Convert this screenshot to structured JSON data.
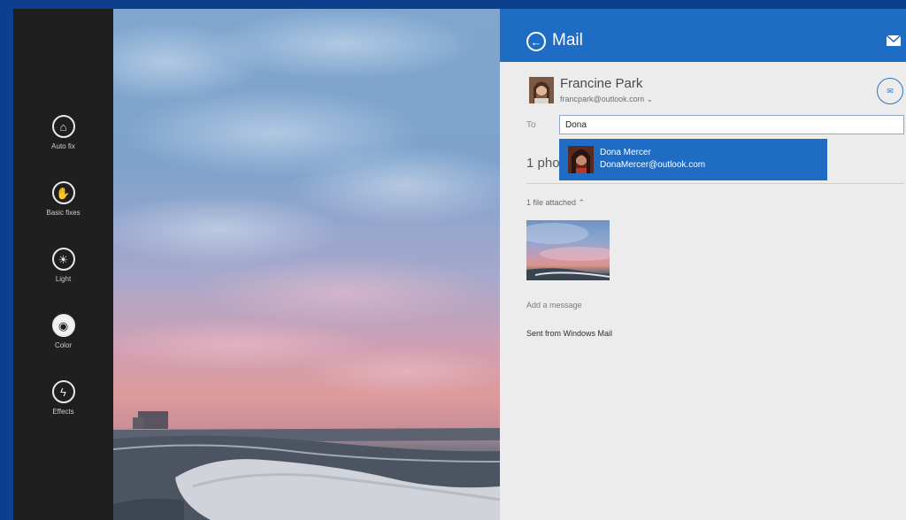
{
  "toolbar": {
    "items": [
      {
        "label": "Auto fix",
        "icon": "auto-fix-icon"
      },
      {
        "label": "Basic fixes",
        "icon": "basic-fixes-icon"
      },
      {
        "label": "Light",
        "icon": "light-icon"
      },
      {
        "label": "Color",
        "icon": "color-icon"
      },
      {
        "label": "Effects",
        "icon": "effects-icon"
      }
    ],
    "active_index": 3
  },
  "mail": {
    "title": "Mail",
    "sender": {
      "name": "Francine Park",
      "email": "francpark@outlook.com ⌄"
    },
    "to_label": "To",
    "to_value": "Dona",
    "subject_text": "1 pho",
    "suggestion": {
      "name": "Dona Mercer",
      "email": "DonaMercer@outlook.com"
    },
    "attachments_label": "1 file attached ⌃",
    "add_message_placeholder": "Add a message",
    "signature": "Sent from Windows Mail"
  },
  "colors": {
    "accent": "#1e6cc4",
    "toolbar_bg": "#1f1f1f",
    "pane_bg": "#ececec",
    "outer_bg": "#0e3e8e"
  }
}
